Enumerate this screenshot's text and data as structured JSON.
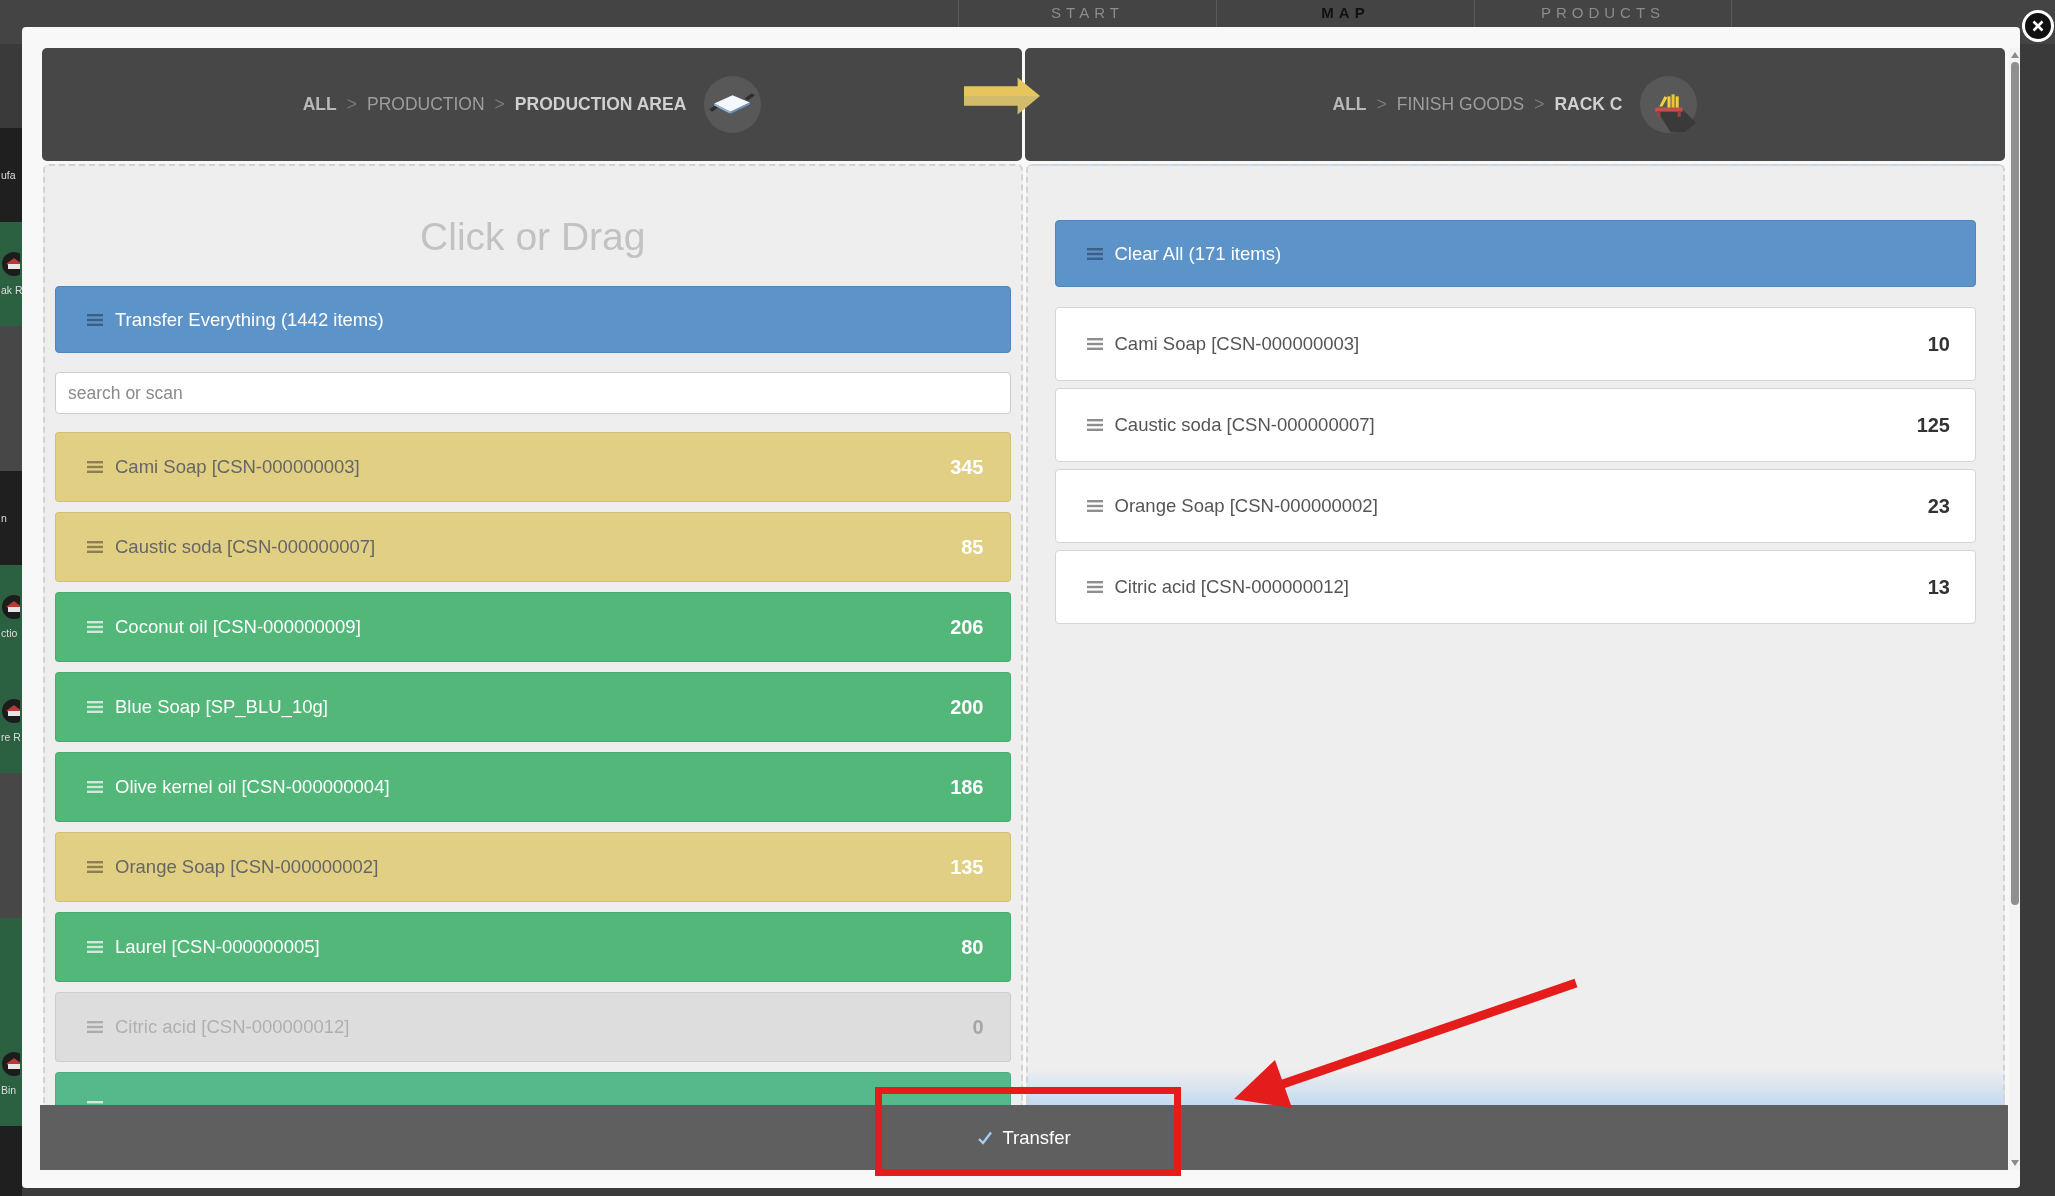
{
  "background": {
    "nav_tabs": [
      {
        "label": "START",
        "selected": false
      },
      {
        "label": "MAP",
        "selected": true
      },
      {
        "label": "PRODUCTS",
        "selected": false
      }
    ],
    "side_cards": [
      {
        "kind": "dark",
        "label": "ufa"
      },
      {
        "kind": "tile",
        "label": "ak R"
      },
      {
        "kind": "grey"
      },
      {
        "kind": "dark",
        "label": "n"
      },
      {
        "kind": "tile",
        "label": "ctio"
      },
      {
        "kind": "tile",
        "label": "re R"
      },
      {
        "kind": "grey"
      },
      {
        "kind": "tile"
      },
      {
        "kind": "tile",
        "label": "Bin"
      },
      {
        "kind": "dark"
      }
    ]
  },
  "transfer": {
    "source": {
      "breadcrumb": [
        {
          "label": "ALL",
          "current": false
        },
        {
          "separator": ">",
          "label": "PRODUCTION",
          "current": false
        },
        {
          "separator": ">",
          "label": "PRODUCTION AREA",
          "current": true
        }
      ],
      "title": "Click or Drag",
      "bulk_action": "Transfer Everything (1442 items)",
      "search": {
        "placeholder": "search or scan"
      },
      "items": [
        {
          "name": "Cami Soap [CSN-000000003]",
          "quantity": "345",
          "color": "#e1cf84",
          "disabled": false
        },
        {
          "name": "Caustic soda [CSN-000000007]",
          "quantity": "85",
          "color": "#e1cf84",
          "disabled": false
        },
        {
          "name": "Coconut oil [CSN-000000009]",
          "quantity": "206",
          "color": "#52b778",
          "disabled": false
        },
        {
          "name": "Blue Soap [SP_BLU_10g]",
          "quantity": "200",
          "color": "#52b778",
          "disabled": false
        },
        {
          "name": "Olive kernel oil [CSN-000000004]",
          "quantity": "186",
          "color": "#52b778",
          "disabled": false
        },
        {
          "name": "Orange Soap [CSN-000000002]",
          "quantity": "135",
          "color": "#e1cf84",
          "disabled": false
        },
        {
          "name": "Laurel [CSN-000000005]",
          "quantity": "80",
          "color": "#52b778",
          "disabled": false
        },
        {
          "name": "Citric acid [CSN-000000012]",
          "quantity": "0",
          "color": "#dddddd",
          "disabled": true
        },
        {
          "color": "#55b98b",
          "disabled": false
        }
      ]
    },
    "destination": {
      "breadcrumb": [
        {
          "label": "ALL",
          "current": false
        },
        {
          "separator": ">",
          "label": "FINISH GOODS",
          "current": false
        },
        {
          "separator": ">",
          "label": "RACK C",
          "current": true
        }
      ],
      "bulk_action": "Clear All (171 items)",
      "items": [
        {
          "name": "Cami Soap [CSN-000000003]",
          "quantity": "10"
        },
        {
          "name": "Caustic soda [CSN-000000007]",
          "quantity": "125"
        },
        {
          "name": "Orange Soap [CSN-000000002]",
          "quantity": "23"
        },
        {
          "name": "Citric acid [CSN-000000012]",
          "quantity": "13"
        }
      ]
    },
    "footer": {
      "button": {
        "label": "Transfer"
      }
    }
  },
  "callout": {
    "frame": true,
    "arrow": true
  }
}
